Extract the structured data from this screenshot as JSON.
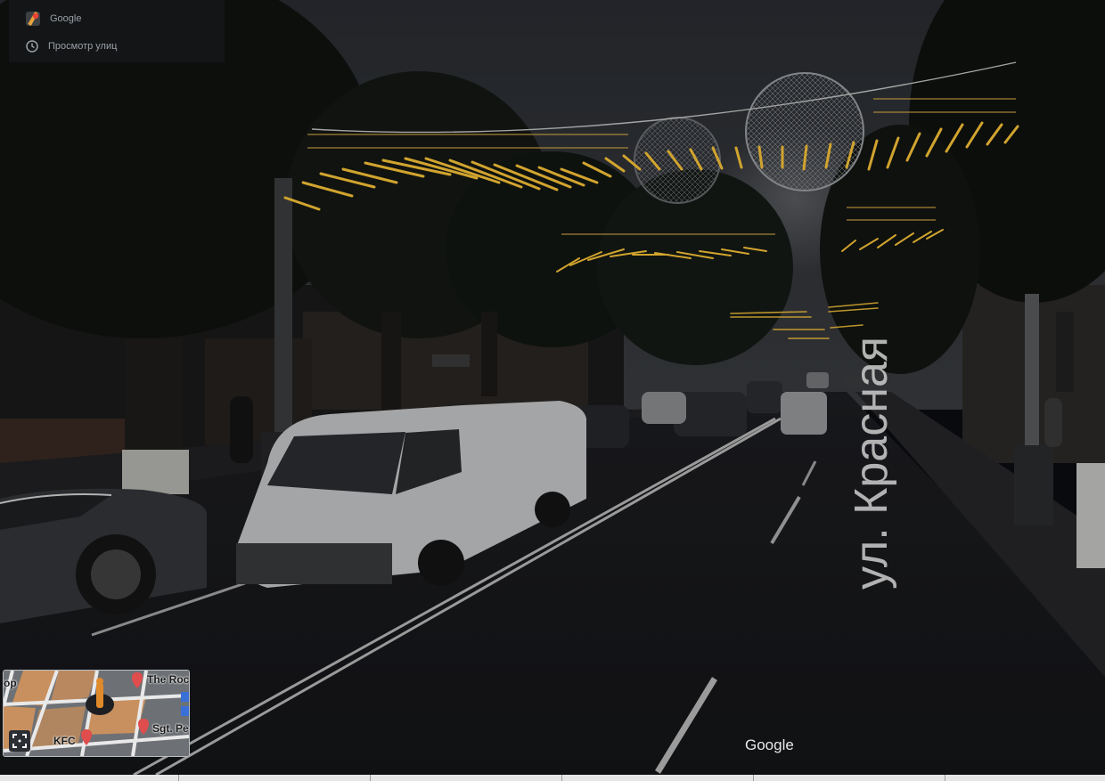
{
  "overlay": {
    "brand_label": "Google",
    "street_view_label": "Просмотр улиц"
  },
  "street": {
    "name": "ул. Красная"
  },
  "watermark": "Google",
  "minimap": {
    "labels": {
      "left_edge": "op",
      "top_right": "The Roc",
      "kfc": "KFC",
      "bottom_right": "Sgt. Pe"
    }
  },
  "colors": {
    "lights": "#ffc83a",
    "asphalt": "#15161a",
    "sky": "#2c2f34"
  }
}
